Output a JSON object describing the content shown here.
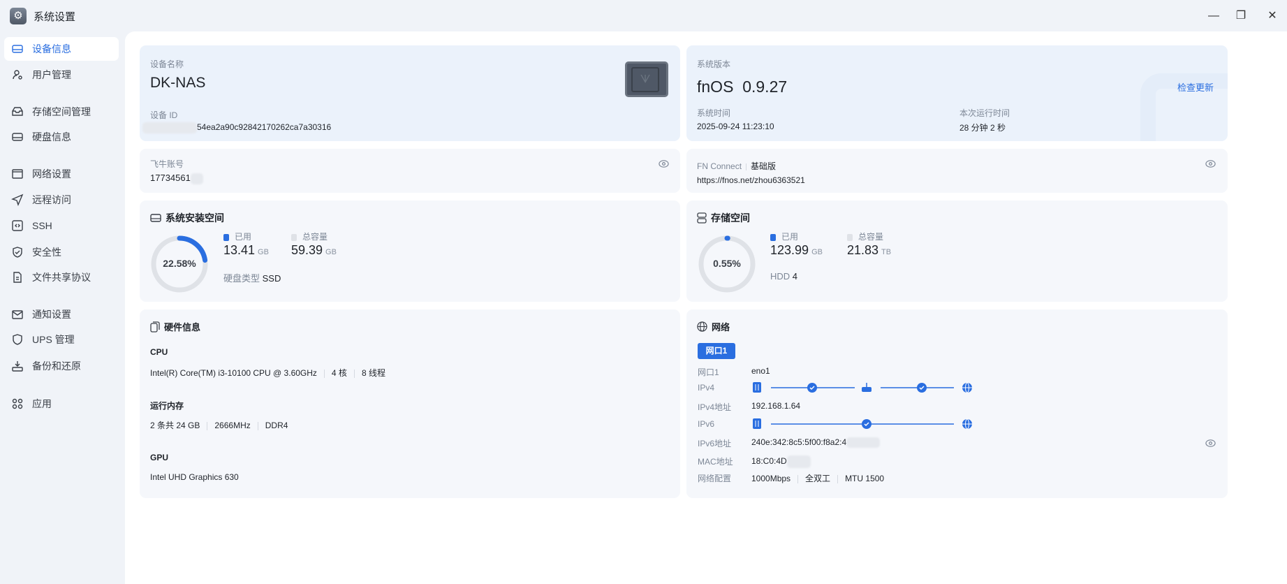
{
  "window": {
    "title": "系统设置",
    "controls": {
      "minimize": "—",
      "restore": "❐",
      "close": "✕"
    }
  },
  "sidebar": {
    "items": [
      {
        "label": "设备信息",
        "icon": "drive-icon",
        "active": true
      },
      {
        "label": "用户管理",
        "icon": "user-gear-icon"
      },
      {
        "label": "存储空间管理",
        "icon": "storage-tray-icon"
      },
      {
        "label": "硬盘信息",
        "icon": "drive-icon"
      },
      {
        "label": "网络设置",
        "icon": "network-window-icon"
      },
      {
        "label": "远程访问",
        "icon": "send-icon"
      },
      {
        "label": "SSH",
        "icon": "code-icon"
      },
      {
        "label": "安全性",
        "icon": "shield-check-icon"
      },
      {
        "label": "文件共享协议",
        "icon": "document-icon"
      },
      {
        "label": "通知设置",
        "icon": "mail-icon"
      },
      {
        "label": "UPS 管理",
        "icon": "shield-icon"
      },
      {
        "label": "备份和还原",
        "icon": "download-tray-icon"
      },
      {
        "label": "应用",
        "icon": "apps-icon"
      }
    ]
  },
  "device": {
    "name_label": "设备名称",
    "name": "DK-NAS",
    "id_label": "设备 ID",
    "id_value": "54ea2a90c92842170262ca7a30316"
  },
  "system": {
    "version_label": "系统版本",
    "os": "fnOS",
    "version": "0.9.27",
    "check_update": "检查更新",
    "time_label": "系统时间",
    "time": "2025-09-24 11:23:10",
    "uptime_label": "本次运行时间",
    "uptime": "28 分钟 2 秒"
  },
  "account": {
    "label": "飞牛账号",
    "value": "17734561"
  },
  "fn_connect": {
    "label": "FN Connect",
    "tier": "基础版",
    "url": "https://fnos.net/zhou6363521"
  },
  "install_space": {
    "title": "系统安装空间",
    "percent_text": "22.58%",
    "percent": 22.58,
    "used_label": "已用",
    "used": "13.41",
    "used_unit": "GB",
    "total_label": "总容量",
    "total": "59.39",
    "total_unit": "GB",
    "disk_type_label": "硬盘类型",
    "disk_type": "SSD"
  },
  "storage": {
    "title": "存储空间",
    "percent_text": "0.55%",
    "percent": 0.55,
    "used_label": "已用",
    "used": "123.99",
    "used_unit": "GB",
    "total_label": "总容量",
    "total": "21.83",
    "total_unit": "TB",
    "hdd_label": "HDD",
    "hdd_count": "4"
  },
  "hardware": {
    "title": "硬件信息",
    "cpu_label": "CPU",
    "cpu_model": "Intel(R) Core(TM) i3-10100 CPU @ 3.60GHz",
    "cpu_cores": "4 核",
    "cpu_threads": "8 线程",
    "mem_label": "运行内存",
    "mem_size": "2 条共 24 GB",
    "mem_speed": "2666MHz",
    "mem_type": "DDR4",
    "gpu_label": "GPU",
    "gpu_model": "Intel UHD Graphics 630"
  },
  "network": {
    "title": "网络",
    "tab": "网口1",
    "rows": {
      "port_label": "网口1",
      "port": "eno1",
      "ipv4_label": "IPv4",
      "ipv4_addr_label": "IPv4地址",
      "ipv4_addr": "192.168.1.64",
      "ipv6_label": "IPv6",
      "ipv6_addr_label": "IPv6地址",
      "ipv6_addr": "240e:342:8c5:5f00:f8a2:4",
      "mac_label": "MAC地址",
      "mac": "18:C0:4D",
      "config_label": "网络配置",
      "speed": "1000Mbps",
      "duplex": "全双工",
      "mtu": "MTU 1500"
    }
  },
  "colors": {
    "accent": "#2a6ee0",
    "ring_track": "#dfe2e7"
  }
}
